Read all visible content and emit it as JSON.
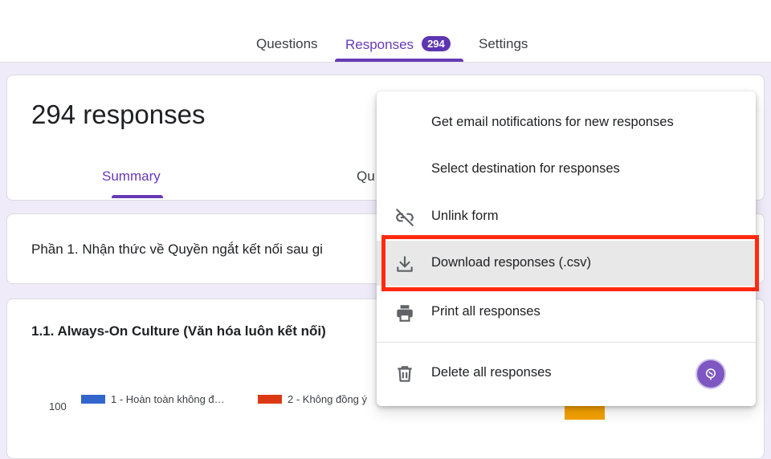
{
  "tabs": {
    "questions": "Questions",
    "responses": "Responses",
    "responses_badge": "294",
    "settings": "Settings"
  },
  "responses_card": {
    "title": "294 responses",
    "subtabs": {
      "summary": "Summary",
      "question": "Qu"
    }
  },
  "section": {
    "title": "Phần 1. Nhận thức về Quyền ngắt kết nối sau gi"
  },
  "question": {
    "title": "1.1. Always-On Culture (Văn hóa luôn kết nối)",
    "y_tick": "100",
    "legend": [
      {
        "label": "1 - Hoàn toàn không đ…",
        "color": "#3366cc"
      },
      {
        "label": "2 - Không đồng ý",
        "color": "#dc3912"
      }
    ],
    "peek_bar_color": "#f4a100"
  },
  "menu": {
    "items": [
      {
        "label": "Get email notifications for new responses",
        "icon": ""
      },
      {
        "label": "Select destination for responses",
        "icon": ""
      },
      {
        "label": "Unlink form",
        "icon": "unlink-icon"
      },
      {
        "label": "Download responses (.csv)",
        "icon": "download-icon"
      },
      {
        "label": "Print all responses",
        "icon": "print-icon"
      },
      {
        "label": "Delete all responses",
        "icon": "trash-icon"
      }
    ]
  },
  "colors": {
    "accent": "#673ab7",
    "highlight": "#ff2a10",
    "background": "#f0ebf8"
  }
}
